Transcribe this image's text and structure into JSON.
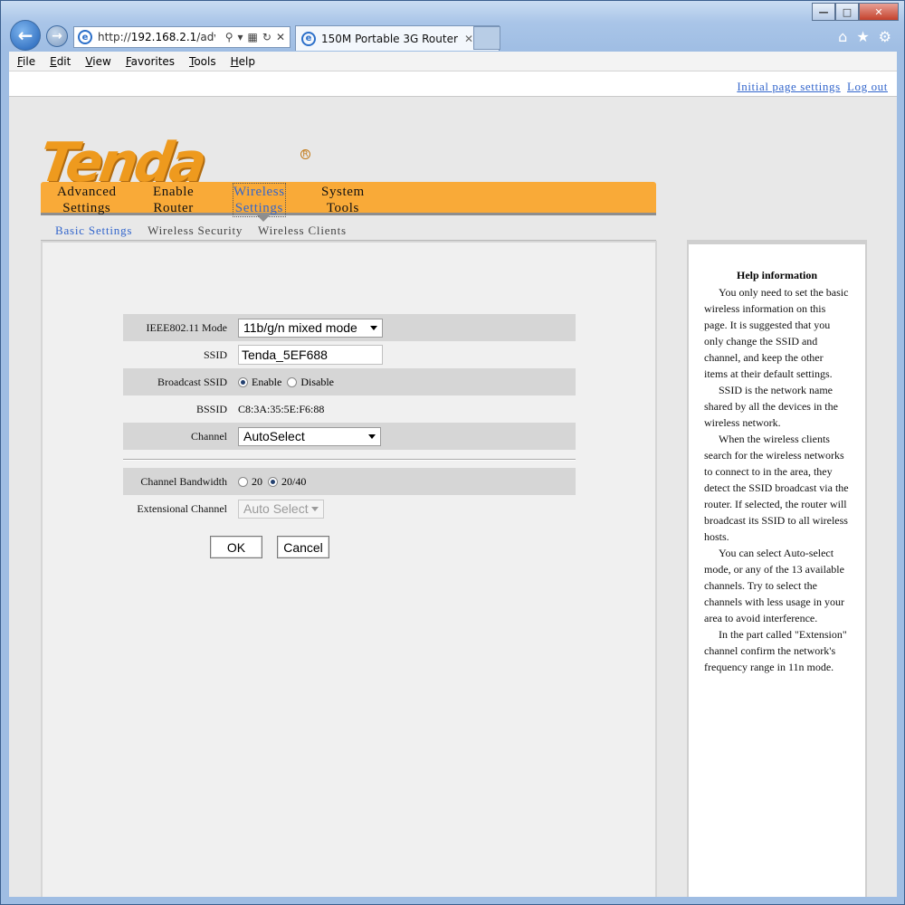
{
  "browser": {
    "address_prefix": "http://",
    "address_host": "192.168.2.1",
    "address_rest": "/advan",
    "tab_title": "150M Portable 3G Router",
    "menu": [
      "File",
      "Edit",
      "View",
      "Favorites",
      "Tools",
      "Help"
    ]
  },
  "toplinks": {
    "initial": "Initial page settings",
    "logout": "Log out"
  },
  "logo": {
    "text": "Tenda",
    "registered": "R"
  },
  "mainnav": [
    {
      "line1": "Advanced",
      "line2": "Settings"
    },
    {
      "line1": "Enable",
      "line2": "Router"
    },
    {
      "line1": "Wireless",
      "line2": "Settings"
    },
    {
      "line1": "System",
      "line2": "Tools"
    }
  ],
  "subnav": [
    "Basic Settings",
    "Wireless Security",
    "Wireless Clients"
  ],
  "form": {
    "mode_label": "IEEE802.11 Mode",
    "mode_value": "11b/g/n mixed mode",
    "ssid_label": "SSID",
    "ssid_value": "Tenda_5EF688",
    "broadcast_label": "Broadcast SSID",
    "broadcast_enable": "Enable",
    "broadcast_disable": "Disable",
    "bssid_label": "BSSID",
    "bssid_value": "C8:3A:35:5E:F6:88",
    "channel_label": "Channel",
    "channel_value": "AutoSelect",
    "bandwidth_label": "Channel Bandwidth",
    "bw_20": "20",
    "bw_2040": "20/40",
    "ext_label": "Extensional Channel",
    "ext_value": "Auto Select",
    "ok": "OK",
    "cancel": "Cancel"
  },
  "help": {
    "title": "Help information",
    "paragraphs": [
      "You only need to set the basic wireless information on this page. It is suggested that you only change the SSID and channel, and keep the other items at their default settings.",
      "SSID is the network name shared by all the devices in the wireless network.",
      "When the wireless clients search for the wireless networks to connect to in the area, they detect the SSID broadcast via the router. If selected, the router will broadcast its SSID to all wireless hosts.",
      "You can select Auto-select mode, or any of the 13 available channels. Try to select the channels with less usage in your area to avoid interference.",
      "In the part called \"Extension\" channel confirm the network's frequency range in 11n mode."
    ]
  }
}
